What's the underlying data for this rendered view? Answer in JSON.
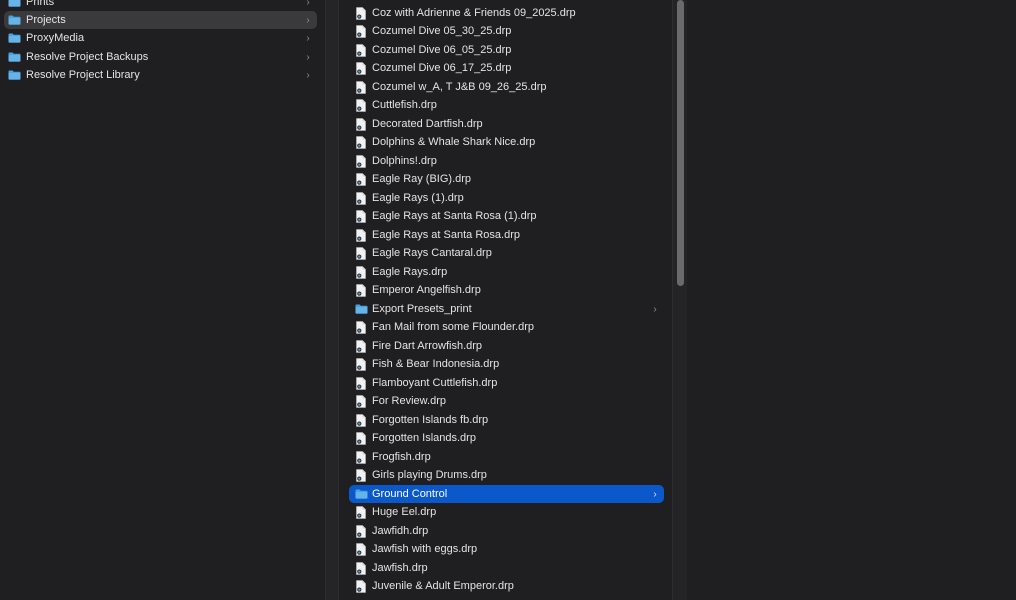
{
  "sidebar": {
    "items": [
      {
        "label": "Prints"
      },
      {
        "label": "Projects"
      },
      {
        "label": "ProxyMedia"
      },
      {
        "label": "Resolve Project Backups"
      },
      {
        "label": "Resolve Project Library"
      }
    ],
    "chevron": "›"
  },
  "files": {
    "items": [
      {
        "label": "Coz with Adrienne & Friends 09_2025.drp"
      },
      {
        "label": "Cozumel Dive 05_30_25.drp"
      },
      {
        "label": "Cozumel Dive 06_05_25.drp"
      },
      {
        "label": "Cozumel Dive 06_17_25.drp"
      },
      {
        "label": "Cozumel w_A, T J&B 09_26_25.drp"
      },
      {
        "label": "Cuttlefish.drp"
      },
      {
        "label": "Decorated Dartfish.drp"
      },
      {
        "label": "Dolphins & Whale Shark Nice.drp"
      },
      {
        "label": "Dolphins!.drp"
      },
      {
        "label": "Eagle Ray (BIG).drp"
      },
      {
        "label": "Eagle Rays (1).drp"
      },
      {
        "label": "Eagle Rays at Santa Rosa (1).drp"
      },
      {
        "label": "Eagle Rays at Santa Rosa.drp"
      },
      {
        "label": "Eagle Rays Cantaral.drp"
      },
      {
        "label": "Eagle Rays.drp"
      },
      {
        "label": "Emperor Angelfish.drp"
      },
      {
        "label": "Export Presets_print"
      },
      {
        "label": "Fan Mail from some Flounder.drp"
      },
      {
        "label": "Fire Dart Arrowfish.drp"
      },
      {
        "label": "Fish & Bear Indonesia.drp"
      },
      {
        "label": "Flamboyant Cuttlefish.drp"
      },
      {
        "label": "For Review.drp"
      },
      {
        "label": "Forgotten Islands fb.drp"
      },
      {
        "label": "Forgotten Islands.drp"
      },
      {
        "label": "Frogfish.drp"
      },
      {
        "label": "Girls playing Drums.drp"
      },
      {
        "label": "Ground Control"
      },
      {
        "label": "Huge Eel.drp"
      },
      {
        "label": "Jawfidh.drp"
      },
      {
        "label": "Jawfish with eggs.drp"
      },
      {
        "label": "Jawfish.drp"
      },
      {
        "label": "Juvenile & Adult Emperor.drp"
      }
    ],
    "chevron": "›"
  },
  "colors": {
    "selection_blue": "#0a58ca",
    "selection_gray": "#3a3a3c",
    "folder_blue": "#4aa3df"
  }
}
